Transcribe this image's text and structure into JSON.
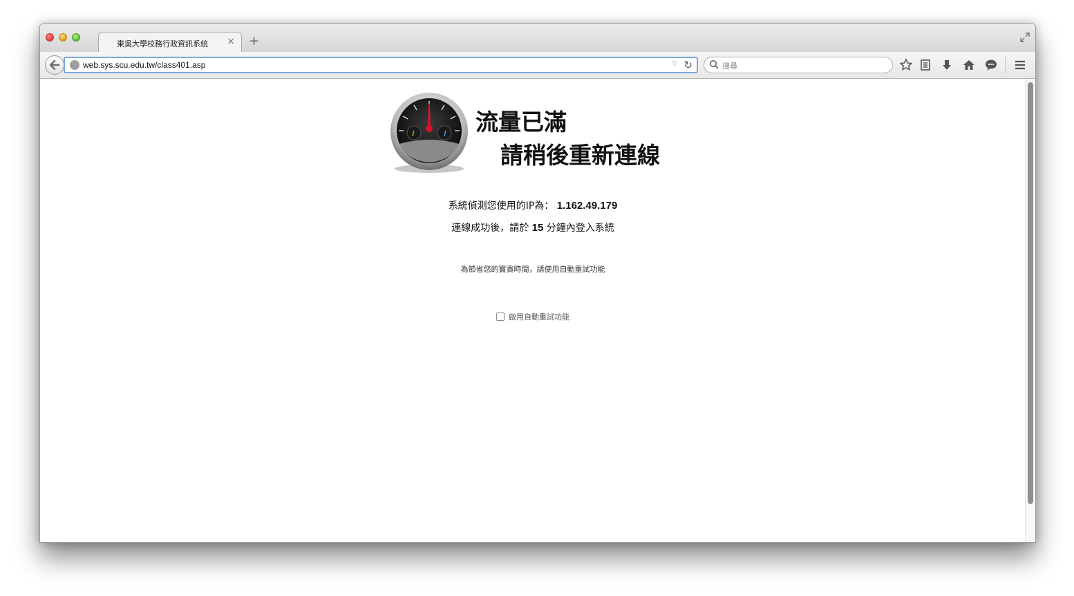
{
  "browser": {
    "tab": {
      "title": "東吳大學校務行政資訊系統",
      "close_glyph": "×"
    },
    "new_tab_glyph": "+",
    "url": "web.sys.scu.edu.tw/class401.asp",
    "search": {
      "placeholder": "搜尋"
    },
    "toolbar_icons": [
      "bookmark-star-icon",
      "reading-list-icon",
      "download-icon",
      "home-icon",
      "chat-icon",
      "menu-icon"
    ]
  },
  "page": {
    "heading_line1": "流量已滿",
    "heading_line2": "請稍後重新連線",
    "ip_label": "系統偵測您使用的IP為：",
    "ip_value": "1.162.49.179",
    "login_prefix": "連線成功後，請於",
    "login_minutes": "15",
    "login_suffix": "分鐘內登入系統",
    "retry_note": "為節省您的寶貴時間，請使用自動重試功能",
    "auto_retry_label": "啟用自動重試功能",
    "auto_retry_checked": false
  },
  "colors": {
    "url_focus": "#7da7dc",
    "gauge_needle": "#e0102a"
  }
}
